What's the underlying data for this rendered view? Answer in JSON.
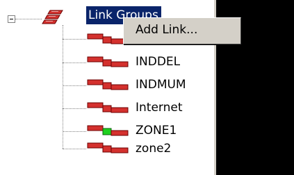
{
  "tree": {
    "root_label": "Link Groups",
    "children": [
      {
        "label": "",
        "icon": "link-icon",
        "status_color": "#d4312e"
      },
      {
        "label": "INDDEL",
        "icon": "link-icon",
        "status_color": "#d4312e"
      },
      {
        "label": "INDMUM",
        "icon": "link-icon",
        "status_color": "#d4312e"
      },
      {
        "label": "Internet",
        "icon": "link-icon",
        "status_color": "#d4312e"
      },
      {
        "label": "ZONE1",
        "icon": "link-icon",
        "status_color": "#1fd11f"
      },
      {
        "label": "zone2",
        "icon": "link-icon",
        "status_color": "#d4312e"
      }
    ]
  },
  "context_menu": {
    "items": [
      "Add Link..."
    ]
  },
  "colors": {
    "selection": "#0a246a",
    "menu_bg": "#d4d0c8",
    "link_red": "#d4312e",
    "link_green": "#1fd11f"
  }
}
